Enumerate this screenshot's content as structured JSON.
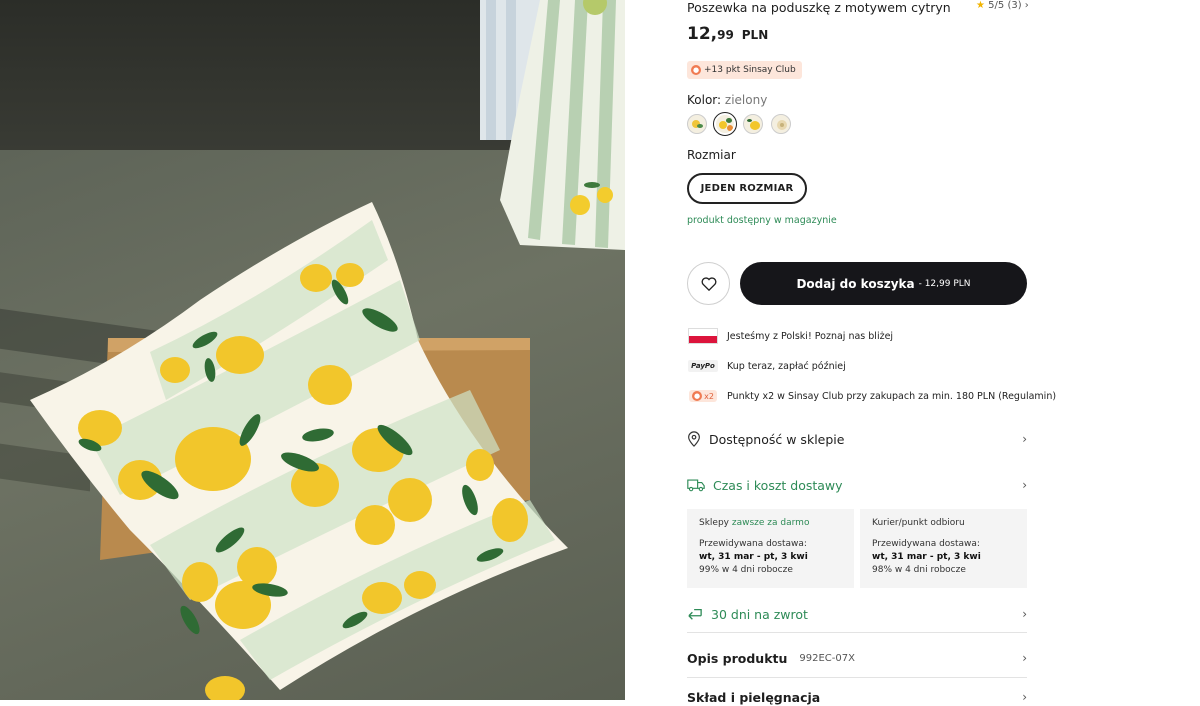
{
  "product": {
    "title": "Poszewka na poduszkę z motywem cytryn",
    "rating": "5/5",
    "reviews": "(3)",
    "price_int": "12,",
    "price_dec": "99",
    "currency": "PLN",
    "club_points": "+13 pkt Sinsay Club",
    "color_label": "Kolor:",
    "color_value": "zielony",
    "size_label": "Rozmiar",
    "size_option": "JEDEN ROZMIAR",
    "availability": "produkt dostępny w magazynie",
    "add_to_cart": "Dodaj do koszyka",
    "add_to_cart_price": "- 12,99 PLN"
  },
  "perks": [
    {
      "icon": "poland-flag-icon",
      "text": "Jesteśmy z Polski! Poznaj nas bliżej"
    },
    {
      "icon": "paypo-icon",
      "icon_text": "PayPo",
      "text": "Kup teraz, zapłać później"
    },
    {
      "icon": "points-x2-icon",
      "icon_text": "x2",
      "text": "Punkty x2 w Sinsay Club przy zakupach za min. 180 PLN (Regulamin)"
    }
  ],
  "sections": {
    "store_availability": "Dostępność w sklepie",
    "delivery": "Czas i koszt dostawy",
    "returns": "30 dni na zwrot",
    "description": "Opis produktu",
    "description_code": "992EC-07X",
    "care": "Skład i pielęgnacja"
  },
  "delivery_cards": [
    {
      "title": "Sklepy",
      "title_accent": "zawsze za darmo",
      "est_label": "Przewidywana dostawa:",
      "dates": "wt, 31 mar - pt, 3 kwi",
      "stat": "99% w 4 dni robocze"
    },
    {
      "title": "Kurier/punkt odbioru",
      "title_accent": "",
      "est_label": "Przewidywana dostawa:",
      "dates": "wt, 31 mar - pt, 3 kwi",
      "stat": "98% w 4 dni robocze"
    }
  ],
  "colors": {
    "accent_green": "#2e8b57",
    "button_dark": "#16161a",
    "club_bg": "#fde6db"
  }
}
